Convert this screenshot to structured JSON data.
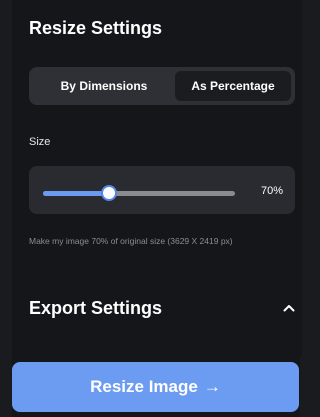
{
  "resize": {
    "title": "Resize Settings",
    "modes": [
      {
        "label": "By Dimensions",
        "active": false
      },
      {
        "label": "As Percentage",
        "active": true
      }
    ],
    "size_label": "Size",
    "slider": {
      "value_percent": 70,
      "value_label": "70%",
      "fill_fraction": 0.34
    },
    "note": "Make my image 70% of original size (3629 X 2419 px)"
  },
  "export": {
    "title": "Export Settings",
    "chevron_icon": "chevron-up-icon"
  },
  "action": {
    "label": "Resize Image",
    "arrow": "→",
    "color": "#6c9bf2"
  }
}
